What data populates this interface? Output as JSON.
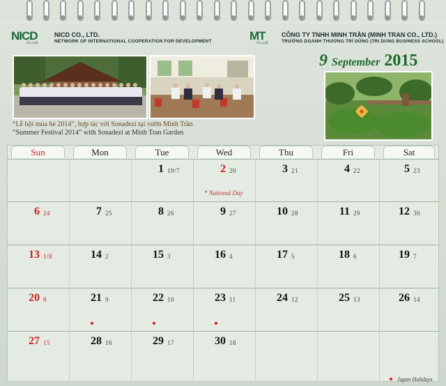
{
  "header": {
    "left_logo": {
      "mark": "NICD",
      "sub": "Co.,Ltd",
      "line1": "NICD CO., LTD.",
      "line2": "NETWORK OF INTERNATIONAL COOPERATION FOR DEVELOPMENT"
    },
    "right_logo": {
      "mark": "MT",
      "sub": "Co.,Ltd",
      "line1": "CÔNG TY TNHH MINH TRẦN (MINH TRAN CO., LTD.)",
      "line2": "TRƯỜNG DOANH THƯƠNG TRÍ DŨNG (TRI DUNG BUSINESS SCHOOL)"
    }
  },
  "captions": {
    "vi": "“Lễ hội mùa hè 2014”, hợp tác với Sonadezi tại vườn Minh Trần",
    "en": "“Summer Festival 2014” with Sonadezi at Minh Tran Garden"
  },
  "month": {
    "day": "9",
    "name": "September",
    "year": "2015"
  },
  "weekdays": [
    "Sun",
    "Mon",
    "Tue",
    "Wed",
    "Thu",
    "Fri",
    "Sat"
  ],
  "weeks": [
    [
      null,
      null,
      {
        "d": "1",
        "l": "19/7"
      },
      {
        "d": "2",
        "l": "20",
        "holiday": true
      },
      {
        "d": "3",
        "l": "21"
      },
      {
        "d": "4",
        "l": "22"
      },
      {
        "d": "5",
        "l": "23"
      }
    ],
    [
      {
        "d": "6",
        "l": "24"
      },
      {
        "d": "7",
        "l": "25"
      },
      {
        "d": "8",
        "l": "26"
      },
      {
        "d": "9",
        "l": "27"
      },
      {
        "d": "10",
        "l": "28"
      },
      {
        "d": "11",
        "l": "29"
      },
      {
        "d": "12",
        "l": "30"
      }
    ],
    [
      {
        "d": "13",
        "l": "1/8"
      },
      {
        "d": "14",
        "l": "2"
      },
      {
        "d": "15",
        "l": "3"
      },
      {
        "d": "16",
        "l": "4"
      },
      {
        "d": "17",
        "l": "5"
      },
      {
        "d": "18",
        "l": "6"
      },
      {
        "d": "19",
        "l": "7"
      }
    ],
    [
      {
        "d": "20",
        "l": "8"
      },
      {
        "d": "21",
        "l": "9"
      },
      {
        "d": "22",
        "l": "10"
      },
      {
        "d": "23",
        "l": "11"
      },
      {
        "d": "24",
        "l": "12"
      },
      {
        "d": "25",
        "l": "13"
      },
      {
        "d": "26",
        "l": "14"
      }
    ],
    [
      {
        "d": "27",
        "l": "15"
      },
      {
        "d": "28",
        "l": "16",
        "jp": true
      },
      {
        "d": "29",
        "l": "17",
        "jp": true
      },
      {
        "d": "30",
        "l": "18",
        "jp": true
      },
      null,
      null,
      null
    ]
  ],
  "national_day_note": "* National Day",
  "legend": "Japan Holidays",
  "colors": {
    "accent_green": "#1b6a2a",
    "sunday_red": "#d0201c"
  }
}
